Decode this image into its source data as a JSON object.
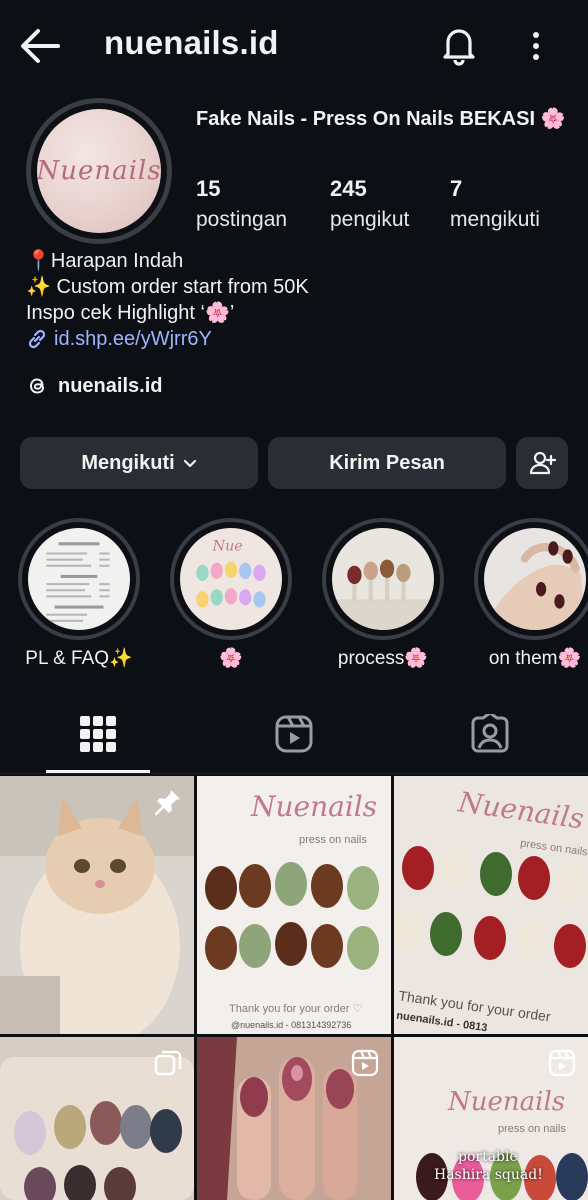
{
  "header": {
    "username": "nuenails.id",
    "back_icon": "back-arrow-icon",
    "bell_icon": "bell-icon",
    "menu_icon": "kebab-menu-icon"
  },
  "profile": {
    "avatar_text": "Nuenails",
    "full_name": "Fake Nails - Press On Nails BEKASI 🌸",
    "stats": [
      {
        "value": "15",
        "label": "postingan"
      },
      {
        "value": "245",
        "label": "pengikut"
      },
      {
        "value": "7",
        "label": "mengikuti"
      }
    ]
  },
  "bio": {
    "line1": "📍Harapan Indah",
    "line2": "✨ Custom order start from 50K",
    "line3": "Inspo cek Highlight ‘🌸’",
    "link": "id.shp.ee/yWjrr6Y"
  },
  "threads": {
    "handle": "nuenails.id"
  },
  "buttons": {
    "following": "Mengikuti",
    "message": "Kirim Pesan"
  },
  "highlights": [
    {
      "label": "PL & FAQ✨"
    },
    {
      "label": "🌸"
    },
    {
      "label": "process🌸"
    },
    {
      "label": "on them🌸"
    }
  ],
  "tabs": {
    "active": "grid",
    "items": [
      "grid-icon",
      "reels-icon",
      "tagged-icon"
    ]
  },
  "posts": [
    {
      "caption": ""
    },
    {
      "brand": "Nuenails",
      "sub": "press on nails",
      "thanks": "Thank you for your order ♡",
      "footer": "@nuenails.id - 081314392736"
    },
    {
      "brand": "Nuenails",
      "sub": "press on nails",
      "thanks": "Thank you for your order",
      "footer": "nuenails.id - 0813"
    },
    {
      "caption": ""
    },
    {
      "caption": ""
    },
    {
      "brand": "Nuenails",
      "sub": "press on nails",
      "overlay1": "portable",
      "overlay2": "Hashira squad!"
    }
  ],
  "colors": {
    "background": "#0c0f14",
    "button": "#2a2d33",
    "link": "#9fb4ff"
  }
}
